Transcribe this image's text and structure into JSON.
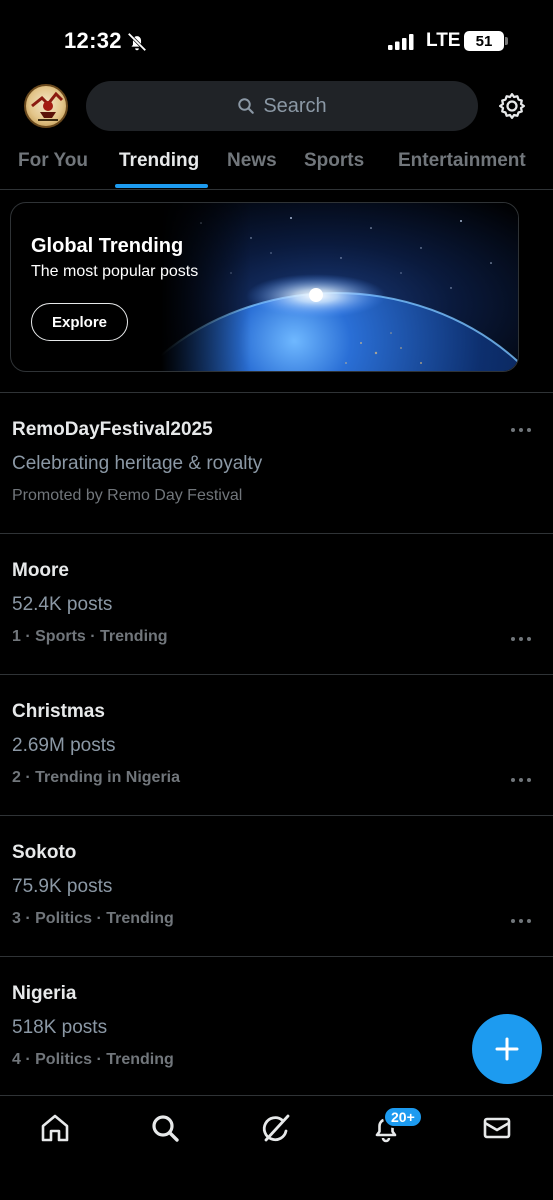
{
  "status_bar": {
    "time": "12:32",
    "network": "LTE",
    "battery": "51"
  },
  "header": {
    "search_placeholder": "Search",
    "avatar_icon": "profile-avatar",
    "settings_icon": "gear-icon"
  },
  "tabs": [
    {
      "label": "For You",
      "active": false
    },
    {
      "label": "Trending",
      "active": true
    },
    {
      "label": "News",
      "active": false
    },
    {
      "label": "Sports",
      "active": false
    },
    {
      "label": "Entertainment",
      "active": false
    }
  ],
  "global_card": {
    "title": "Global Trending",
    "subtitle": "The most popular posts",
    "button_label": "Explore"
  },
  "trends": [
    {
      "title": "RemoDayFestival2025",
      "subtitle": "Celebrating heritage & royalty",
      "meta": "Promoted by Remo Day Festival",
      "promoted": true
    },
    {
      "title": "Moore",
      "subtitle": "52.4K posts",
      "meta": "1 · Sports · Trending",
      "promoted": false
    },
    {
      "title": "Christmas",
      "subtitle": "2.69M posts",
      "meta": "2 · Trending in Nigeria",
      "promoted": false
    },
    {
      "title": "Sokoto",
      "subtitle": "75.9K posts",
      "meta": "3 · Politics · Trending",
      "promoted": false
    },
    {
      "title": "Nigeria",
      "subtitle": "518K posts",
      "meta": "4 · Politics · Trending",
      "promoted": false
    }
  ],
  "bottom_nav": {
    "items": [
      "home-icon",
      "search-icon",
      "grok-icon",
      "notifications-icon",
      "messages-icon"
    ],
    "notification_badge": "20+"
  },
  "colors": {
    "accent": "#1d9bf0",
    "background": "#000000",
    "secondary_text": "#71767b"
  }
}
